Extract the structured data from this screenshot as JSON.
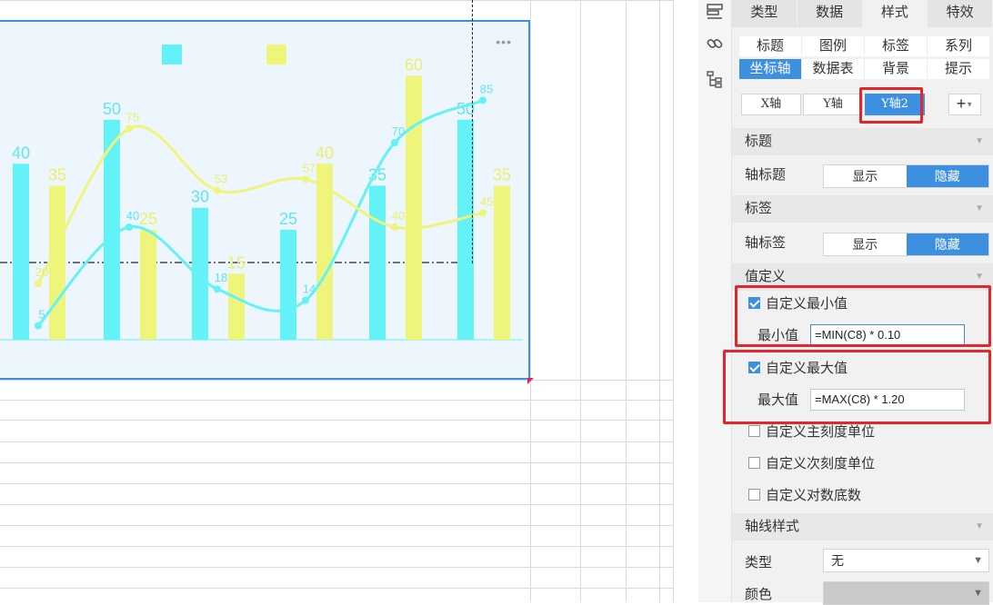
{
  "panel": {
    "main_tabs": [
      "类型",
      "数据",
      "样式",
      "特效"
    ],
    "active_main_tab": "样式",
    "sub_tabs": [
      "标题",
      "图例",
      "标签",
      "系列",
      "坐标轴",
      "数据表",
      "背景",
      "提示"
    ],
    "active_sub_tab": "坐标轴",
    "axis_tabs": [
      "X轴",
      "Y轴",
      "Y轴2"
    ],
    "active_axis_tab": "Y轴2",
    "add_axis_label": "+",
    "sections": {
      "title": {
        "header": "标题",
        "row_label": "轴标题",
        "show": "显示",
        "hide": "隐藏",
        "selected": "隐藏"
      },
      "label": {
        "header": "标签",
        "row_label": "轴标签",
        "show": "显示",
        "hide": "隐藏",
        "selected": "隐藏"
      },
      "value": {
        "header": "值定义",
        "custom_min": {
          "label": "自定义最小值",
          "checked": true
        },
        "min_label": "最小值",
        "min_formula": "=MIN(C8) * 0.10",
        "custom_max": {
          "label": "自定义最大值",
          "checked": true
        },
        "max_label": "最大值",
        "max_formula": "=MAX(C8) * 1.20",
        "major_unit": {
          "label": "自定义主刻度单位",
          "checked": false
        },
        "minor_unit": {
          "label": "自定义次刻度单位",
          "checked": false
        },
        "log_base": {
          "label": "自定义对数底数",
          "checked": false
        }
      },
      "axis_style": {
        "header": "轴线样式",
        "type_label": "类型",
        "type_value": "无",
        "color_label": "颜色"
      }
    },
    "colors": {
      "accent": "#3d8fe0",
      "highlight": "#e3262b"
    }
  },
  "toolstrip": {
    "icons": [
      "layout-icon",
      "link-icon",
      "tree-icon"
    ]
  },
  "chart_data": {
    "type": "bar",
    "more_label": "•••",
    "categories": [
      "",
      "",
      "",
      "",
      "",
      ""
    ],
    "series": [
      {
        "kind": "bar",
        "color": "#62f2f8",
        "values": [
          40,
          50,
          30,
          25,
          35,
          50
        ]
      },
      {
        "kind": "bar",
        "color": "#eff57a",
        "values": [
          35,
          25,
          15,
          40,
          60,
          35
        ]
      },
      {
        "kind": "line",
        "color": "#62f2f8",
        "values": [
          5,
          40,
          18,
          14,
          70,
          85
        ]
      },
      {
        "kind": "line",
        "color": "#eff57a",
        "values": [
          20,
          75,
          53,
          57,
          40,
          45
        ]
      }
    ],
    "ylim": [
      0,
      64
    ],
    "line_ylim": [
      0,
      100
    ],
    "legend_position": "top-center",
    "grid": false,
    "colors": {
      "background": "#edf5fd",
      "border": "#3d8fe0"
    }
  }
}
